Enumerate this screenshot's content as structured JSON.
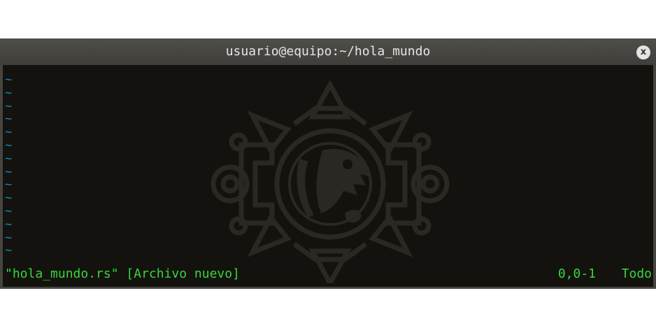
{
  "window": {
    "title": "usuario@equipo:~/hola_mundo",
    "close_glyph": "x"
  },
  "editor": {
    "empty_line_marker": "~",
    "empty_line_count": 14,
    "tilde_color": "#0c8cb5",
    "background": "#13120e"
  },
  "statusline": {
    "file_message": "\"hola_mundo.rs\" [Archivo nuevo]",
    "cursor_position": "0,0-1",
    "scroll_position": "Todo",
    "color": "#37d63a"
  }
}
